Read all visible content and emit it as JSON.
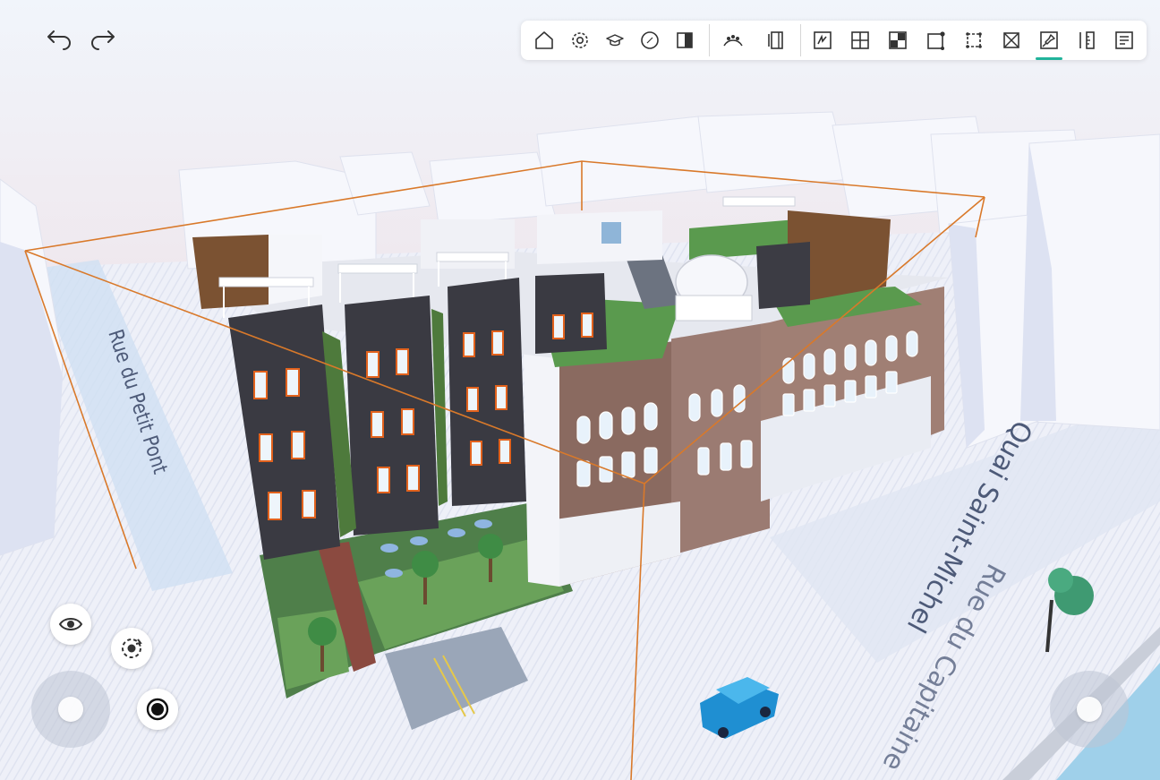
{
  "streets": {
    "petit_pont": "Rue du Petit Pont",
    "saint_michel": "Quai Saint-Michel",
    "capitaine": "Rue du Capitaine"
  },
  "toolbar": {
    "tools": [
      {
        "name": "home-icon"
      },
      {
        "name": "settings-icon"
      },
      {
        "name": "learn-icon"
      },
      {
        "name": "compass-icon"
      },
      {
        "name": "split-view-icon"
      },
      {
        "name": "people-icon"
      },
      {
        "name": "panel-icon"
      },
      {
        "name": "draw-area-icon"
      },
      {
        "name": "grid-icon"
      },
      {
        "name": "texture-icon"
      },
      {
        "name": "edit-shape-icon"
      },
      {
        "name": "selection-icon"
      },
      {
        "name": "remove-icon"
      },
      {
        "name": "pin-icon"
      },
      {
        "name": "measure-icon"
      },
      {
        "name": "report-icon"
      }
    ],
    "active_tool": "pin-icon"
  },
  "colors": {
    "accent": "#21b39b",
    "bounding_box": "#d9792a",
    "sky": "#e9ebf6",
    "water": "#9fd0ea"
  }
}
